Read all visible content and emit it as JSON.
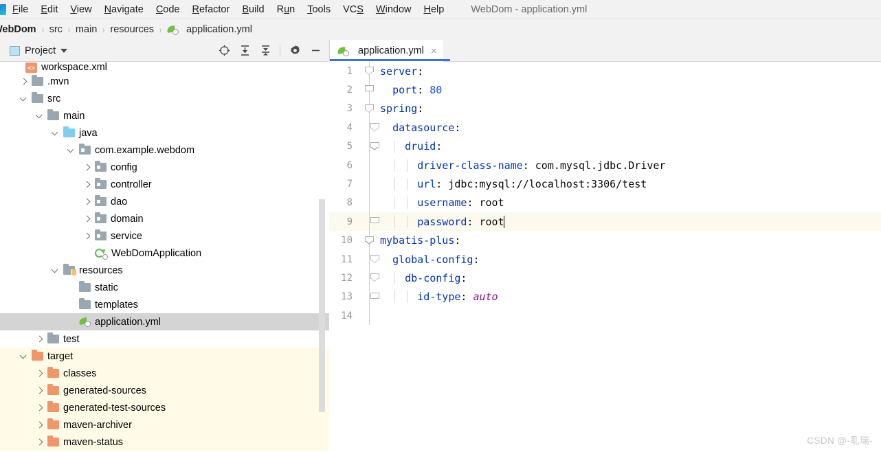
{
  "window": {
    "title": "WebDom - application.yml"
  },
  "menubar": {
    "items": [
      {
        "label": "File",
        "mnemonic": "F"
      },
      {
        "label": "Edit",
        "mnemonic": "E"
      },
      {
        "label": "View",
        "mnemonic": "V"
      },
      {
        "label": "Navigate",
        "mnemonic": "N"
      },
      {
        "label": "Code",
        "mnemonic": "C"
      },
      {
        "label": "Refactor",
        "mnemonic": "R"
      },
      {
        "label": "Build",
        "mnemonic": "B"
      },
      {
        "label": "Run",
        "mnemonic": "u"
      },
      {
        "label": "Tools",
        "mnemonic": "T"
      },
      {
        "label": "VCS",
        "mnemonic": "S"
      },
      {
        "label": "Window",
        "mnemonic": "W"
      },
      {
        "label": "Help",
        "mnemonic": "H"
      }
    ]
  },
  "breadcrumb": {
    "separator": "›",
    "items": [
      "WebDom",
      "src",
      "main",
      "resources",
      "application.yml"
    ]
  },
  "tool_window": {
    "title": "Project",
    "actions": [
      {
        "name": "locate-icon",
        "tooltip": "Select Opened File"
      },
      {
        "name": "expand-all-icon",
        "tooltip": "Expand All"
      },
      {
        "name": "collapse-all-icon",
        "tooltip": "Collapse All"
      },
      {
        "name": "settings-gear-icon",
        "tooltip": "Settings"
      },
      {
        "name": "hide-icon",
        "tooltip": "Hide"
      }
    ]
  },
  "editor_tabs": [
    {
      "label": "application.yml",
      "icon": "yml-file-icon",
      "close": "×",
      "active": true
    }
  ],
  "project_tree": [
    {
      "label": "workspace.xml",
      "depth": 2,
      "arrow": "none",
      "icon": "xml-file",
      "state": "clipped"
    },
    {
      "label": ".mvn",
      "depth": 1,
      "arrow": "right",
      "icon": "folder"
    },
    {
      "label": "src",
      "depth": 1,
      "arrow": "down",
      "icon": "folder"
    },
    {
      "label": "main",
      "depth": 2,
      "arrow": "down",
      "icon": "folder"
    },
    {
      "label": "java",
      "depth": 3,
      "arrow": "down",
      "icon": "folder-blue"
    },
    {
      "label": "com.example.webdom",
      "depth": 4,
      "arrow": "down",
      "icon": "folder-pkg"
    },
    {
      "label": "config",
      "depth": 5,
      "arrow": "right",
      "icon": "folder-pkg"
    },
    {
      "label": "controller",
      "depth": 5,
      "arrow": "right",
      "icon": "folder-pkg"
    },
    {
      "label": "dao",
      "depth": 5,
      "arrow": "right",
      "icon": "folder-pkg"
    },
    {
      "label": "domain",
      "depth": 5,
      "arrow": "right",
      "icon": "folder-pkg"
    },
    {
      "label": "service",
      "depth": 5,
      "arrow": "right",
      "icon": "folder-pkg"
    },
    {
      "label": "WebDomApplication",
      "depth": 5,
      "arrow": "none",
      "icon": "spring-class"
    },
    {
      "label": "resources",
      "depth": 3,
      "arrow": "down",
      "icon": "folder-res"
    },
    {
      "label": "static",
      "depth": 4,
      "arrow": "none",
      "icon": "folder"
    },
    {
      "label": "templates",
      "depth": 4,
      "arrow": "none",
      "icon": "folder"
    },
    {
      "label": "application.yml",
      "depth": 4,
      "arrow": "none",
      "icon": "yml-file",
      "state": "selected"
    },
    {
      "label": "test",
      "depth": 2,
      "arrow": "right",
      "icon": "folder"
    },
    {
      "label": "target",
      "depth": 1,
      "arrow": "down",
      "icon": "folder-orange",
      "state": "excluded"
    },
    {
      "label": "classes",
      "depth": 2,
      "arrow": "right",
      "icon": "folder-orange",
      "state": "excluded"
    },
    {
      "label": "generated-sources",
      "depth": 2,
      "arrow": "right",
      "icon": "folder-orange",
      "state": "excluded"
    },
    {
      "label": "generated-test-sources",
      "depth": 2,
      "arrow": "right",
      "icon": "folder-orange",
      "state": "excluded"
    },
    {
      "label": "maven-archiver",
      "depth": 2,
      "arrow": "right",
      "icon": "folder-orange",
      "state": "excluded"
    },
    {
      "label": "maven-status",
      "depth": 2,
      "arrow": "right",
      "icon": "folder-orange",
      "state": "excluded"
    }
  ],
  "editor": {
    "filename": "application.yml",
    "language": "yaml",
    "caret_line": 9,
    "caret_column": 22,
    "lines": [
      {
        "num": 1,
        "indent": 0,
        "fold": "start",
        "text": "server:"
      },
      {
        "num": 2,
        "indent": 1,
        "fold": "end",
        "text": "  port: 80"
      },
      {
        "num": 3,
        "indent": 0,
        "fold": "start",
        "text": "spring:"
      },
      {
        "num": 4,
        "indent": 1,
        "fold": "start",
        "text": "  datasource:"
      },
      {
        "num": 5,
        "indent": 2,
        "fold": "start",
        "text": "    druid:"
      },
      {
        "num": 6,
        "indent": 3,
        "fold": "none",
        "text": "      driver-class-name: com.mysql.jdbc.Driver"
      },
      {
        "num": 7,
        "indent": 3,
        "fold": "none",
        "text": "      url: jdbc:mysql://localhost:3306/test"
      },
      {
        "num": 8,
        "indent": 3,
        "fold": "none",
        "text": "      username: root"
      },
      {
        "num": 9,
        "indent": 3,
        "fold": "end",
        "text": "      password: root"
      },
      {
        "num": 10,
        "indent": 0,
        "fold": "start",
        "text": "mybatis-plus:"
      },
      {
        "num": 11,
        "indent": 1,
        "fold": "start",
        "text": "  global-config:"
      },
      {
        "num": 12,
        "indent": 2,
        "fold": "start",
        "text": "    db-config:"
      },
      {
        "num": 13,
        "indent": 3,
        "fold": "end",
        "text": "      id-type: auto"
      },
      {
        "num": 14,
        "indent": 0,
        "fold": "none",
        "text": ""
      }
    ]
  },
  "watermark": {
    "text": "CSDN @-耴瑞-"
  },
  "colors": {
    "key": "#0033B3",
    "number": "#1750EB",
    "value": "#080808",
    "enum_value": "#871094",
    "tab_underline": "#3C76C8",
    "selection": "#D4D4D4",
    "excluded_bg": "#FFFBE6",
    "caret_line_bg": "#FCFAEF",
    "chrome_bg": "#F2F2F2"
  }
}
